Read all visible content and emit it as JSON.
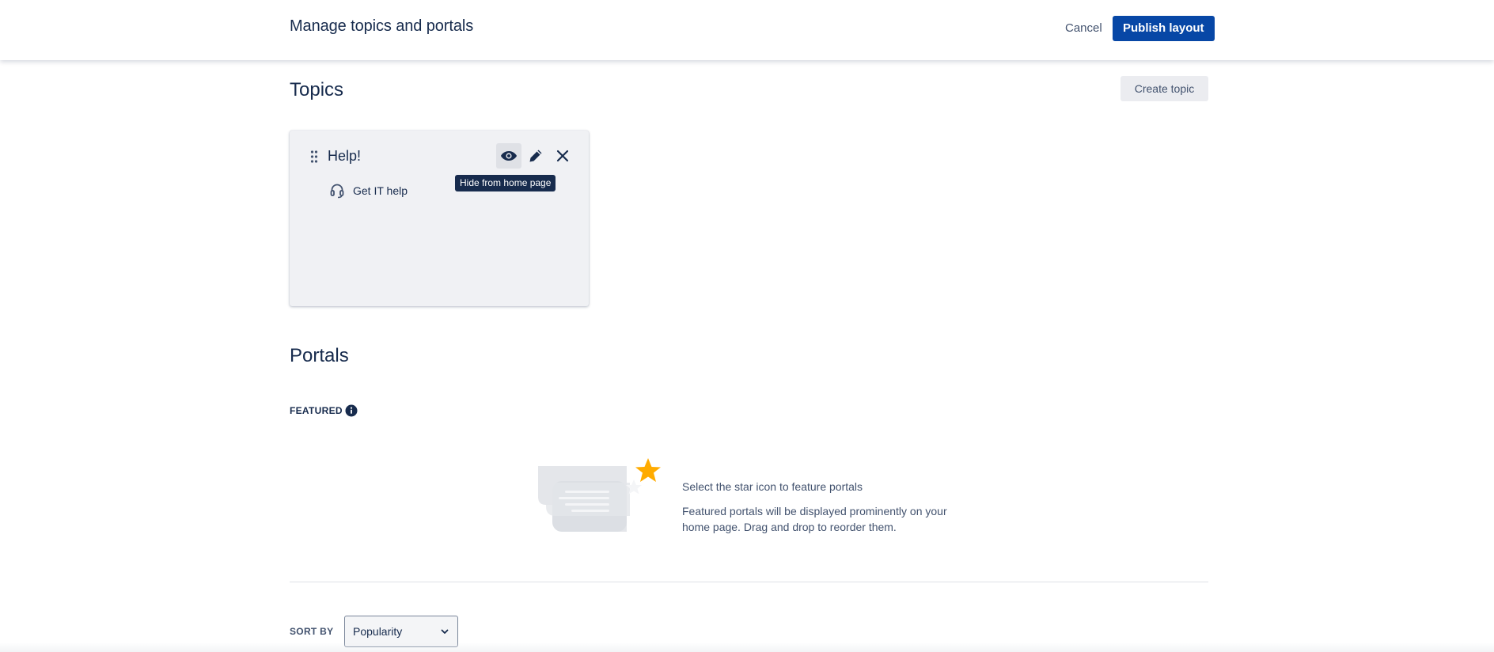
{
  "header": {
    "title": "Manage topics and portals",
    "cancel_label": "Cancel",
    "publish_label": "Publish layout"
  },
  "topics": {
    "title": "Topics",
    "create_label": "Create topic",
    "cards": [
      {
        "title": "Help!",
        "tooltip": "Hide from home page",
        "portals": [
          {
            "label": "Get IT help",
            "icon": "headset-icon"
          }
        ]
      }
    ]
  },
  "portals": {
    "title": "Portals",
    "featured_label": "FEATURED",
    "empty_state": {
      "heading": "Select the star icon to feature portals",
      "description": "Featured portals will be displayed prominently on your home page. Drag and drop to reorder them."
    },
    "sort": {
      "label": "SORT BY",
      "selected": "Popularity"
    }
  },
  "colors": {
    "primary": "#0747a6",
    "text": "#172b4d",
    "subtle_text": "#42526e",
    "card_bg": "#f0f1f4",
    "star": "#ffab00"
  }
}
